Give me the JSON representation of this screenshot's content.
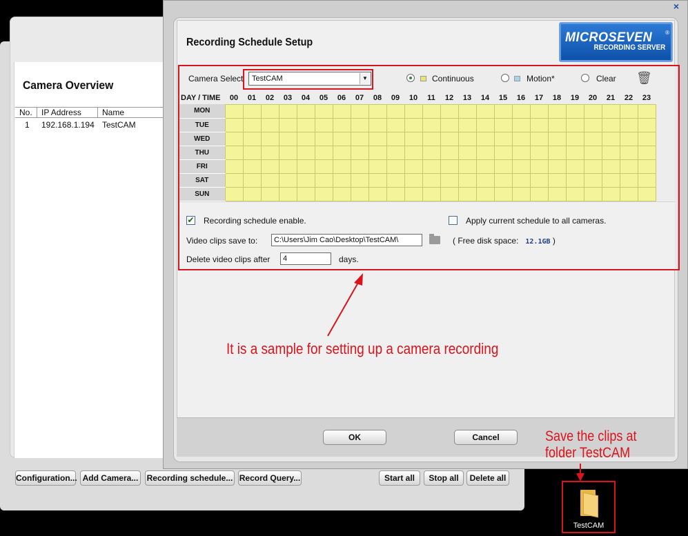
{
  "overview": {
    "title": "Camera Overview",
    "columns": [
      "No.",
      "IP Address",
      "Name"
    ],
    "rows": [
      {
        "no": "1",
        "ip": "192.168.1.194",
        "name": "TestCAM"
      }
    ],
    "buttons": [
      "Configuration...",
      "Add Camera...",
      "Recording schedule...",
      "Record Query...",
      "Start all",
      "Stop all",
      "Delete all"
    ]
  },
  "dialog": {
    "title": "Recording Schedule Setup",
    "close_icon": "×",
    "logo": {
      "main": "MICROSEVEN",
      "reg": "®",
      "sub": "RECORDING SERVER"
    },
    "camera_select": {
      "label": "Camera Select",
      "value": "TestCAM",
      "arrow": "▼"
    },
    "modes": [
      {
        "label": "Continuous",
        "selected": true,
        "color": "#e8e870"
      },
      {
        "label": "Motion*",
        "selected": false,
        "color": "#a9d3e6"
      },
      {
        "label": "Clear",
        "selected": false
      }
    ],
    "trash_icon": "🗑",
    "grid": {
      "corner_label": "DAY / TIME",
      "hours": [
        "00",
        "01",
        "02",
        "03",
        "04",
        "05",
        "06",
        "07",
        "08",
        "09",
        "10",
        "11",
        "12",
        "13",
        "14",
        "15",
        "16",
        "17",
        "18",
        "19",
        "20",
        "21",
        "22",
        "23"
      ],
      "days": [
        "MON",
        "TUE",
        "WED",
        "THU",
        "FRI",
        "SAT",
        "SUN"
      ],
      "all_cells": "Continuous",
      "cell_color": "#f4f49a"
    },
    "schedule_enable": {
      "label": "Recording schedule enable.",
      "checked": true,
      "mark": "✔"
    },
    "apply_all": {
      "label": "Apply current schedule to all cameras.",
      "checked": false
    },
    "save_to": {
      "label": "Video clips save to:",
      "value": "C:\\Users\\Jim Cao\\Desktop\\TestCAM\\"
    },
    "free_disk": {
      "prefix": "( Free disk space:",
      "value": "12.1GB",
      "suffix": ")"
    },
    "delete_after": {
      "label": "Delete video clips after",
      "value": "4",
      "unit": "days."
    },
    "ok": "OK",
    "cancel": "Cancel"
  },
  "annotations": {
    "main": "It is a sample for setting up a camera recording",
    "save_line1": "Save the clips at",
    "save_line2": "folder TestCAM",
    "color": "#d9141c"
  },
  "desktop": {
    "folder_label": "TestCAM"
  }
}
